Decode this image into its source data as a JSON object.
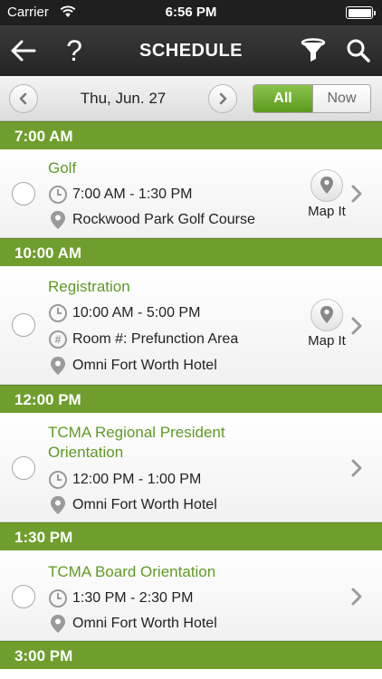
{
  "status_bar": {
    "carrier": "Carrier",
    "time": "6:56 PM"
  },
  "nav": {
    "title": "SCHEDULE",
    "help_label": "?"
  },
  "date_bar": {
    "date": "Thu, Jun. 27",
    "filter_all": "All",
    "filter_now": "Now",
    "selected_filter": "All"
  },
  "map_it_label": "Map It",
  "colors": {
    "accent_green": "#6f9e2e",
    "title_green": "#5f9a25",
    "nav_dark": "#2b2b2b"
  },
  "sections": [
    {
      "time": "7:00 AM"
    },
    {
      "time": "10:00 AM"
    },
    {
      "time": "12:00 PM"
    },
    {
      "time": "1:30 PM"
    },
    {
      "time": "3:00 PM"
    }
  ],
  "events": [
    {
      "title": "Golf",
      "time_range": "7:00 AM - 1:30 PM",
      "location": "Rockwood Park Golf Course"
    },
    {
      "title": "Registration",
      "time_range": "10:00 AM - 5:00 PM",
      "room": "Room #: Prefunction Area",
      "location": "Omni Fort Worth Hotel"
    },
    {
      "title": "TCMA Regional President Orientation",
      "time_range": "12:00 PM - 1:00 PM",
      "location": "Omni Fort Worth Hotel"
    },
    {
      "title": "TCMA Board Orientation",
      "time_range": "1:30 PM - 2:30 PM",
      "location": "Omni Fort Worth Hotel"
    }
  ]
}
